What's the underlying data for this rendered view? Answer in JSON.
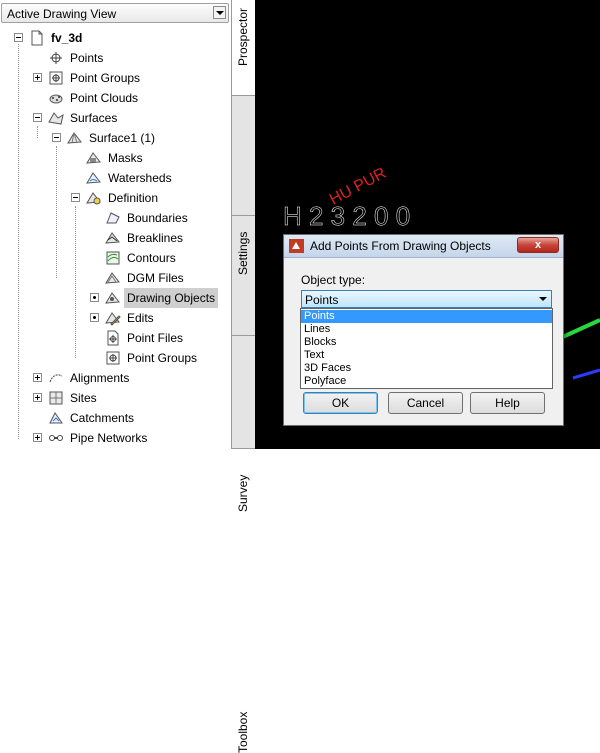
{
  "view_dropdown": {
    "value": "Active Drawing View"
  },
  "tree": {
    "items": [
      {
        "label": "fv_3d"
      },
      {
        "label": "Points"
      },
      {
        "label": "Point Groups"
      },
      {
        "label": "Point Clouds"
      },
      {
        "label": "Surfaces"
      },
      {
        "label": "Surface1 (1)"
      },
      {
        "label": "Masks"
      },
      {
        "label": "Watersheds"
      },
      {
        "label": "Definition"
      },
      {
        "label": "Boundaries"
      },
      {
        "label": "Breaklines"
      },
      {
        "label": "Contours"
      },
      {
        "label": "DGM Files"
      },
      {
        "label": "Drawing Objects"
      },
      {
        "label": "Edits"
      },
      {
        "label": "Point Files"
      },
      {
        "label": "Point Groups"
      },
      {
        "label": "Alignments"
      },
      {
        "label": "Sites"
      },
      {
        "label": "Catchments"
      },
      {
        "label": "Pipe Networks"
      }
    ]
  },
  "tabs": [
    "Prospector",
    "Settings",
    "Survey",
    "Toolbox"
  ],
  "canvas": {
    "text_large": "H 2 3 2 0 0",
    "text_red": "HU PUR"
  },
  "dialog": {
    "title": "Add Points From Drawing Objects",
    "close_label": "x",
    "object_type_label": "Object type:",
    "selected": "Points",
    "options": [
      "Points",
      "Lines",
      "Blocks",
      "Text",
      "3D Faces",
      "Polyface"
    ],
    "ok_label": "OK",
    "cancel_label": "Cancel",
    "help_label": "Help"
  },
  "colors": {
    "accent": "#3399ff",
    "selection": "#cfcfcf",
    "canvas": "#000000"
  }
}
